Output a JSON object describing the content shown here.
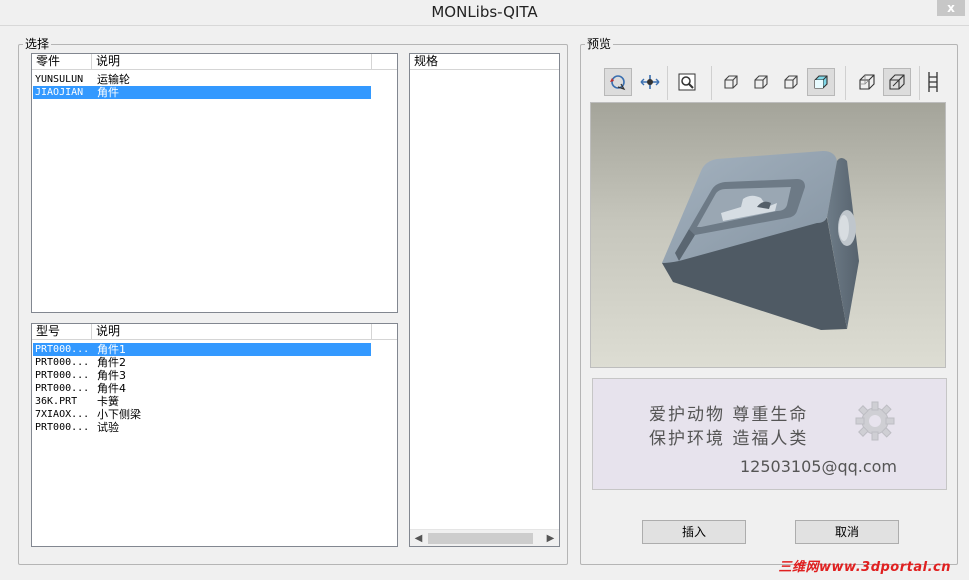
{
  "window": {
    "title": "MONLibs-QITA",
    "close_label": "x"
  },
  "select_group": {
    "label": "选择",
    "parts_list": {
      "headers": [
        "零件",
        "说明"
      ],
      "rows": [
        {
          "name": "YUNSULUN",
          "desc": "运输轮",
          "selected": false
        },
        {
          "name": "JIAOJIAN",
          "desc": "角件",
          "selected": true
        }
      ]
    },
    "models_list": {
      "headers": [
        "型号",
        "说明"
      ],
      "rows": [
        {
          "name": "PRT000...",
          "desc": "角件1",
          "selected": true
        },
        {
          "name": "PRT000...",
          "desc": "角件2",
          "selected": false
        },
        {
          "name": "PRT000...",
          "desc": "角件3",
          "selected": false
        },
        {
          "name": "PRT000...",
          "desc": "角件4",
          "selected": false
        },
        {
          "name": "36K.PRT",
          "desc": "卡簧",
          "selected": false
        },
        {
          "name": "7XIAOX...",
          "desc": "小下侧梁",
          "selected": false
        },
        {
          "name": "PRT000...",
          "desc": "试验",
          "selected": false
        }
      ]
    },
    "spec_list": {
      "header": "规格",
      "rows": []
    }
  },
  "preview_group": {
    "label": "预览",
    "toolbar": [
      {
        "icon": "spin-icon",
        "pressed": true
      },
      {
        "icon": "pan-icon",
        "pressed": false
      },
      {
        "icon": "zoom-window-icon",
        "pressed": false
      },
      {
        "icon": "view-front-icon",
        "pressed": false
      },
      {
        "icon": "view-back-icon",
        "pressed": false
      },
      {
        "icon": "view-side-icon",
        "pressed": false
      },
      {
        "icon": "shaded-view-icon",
        "pressed": true
      },
      {
        "icon": "wireframe-view-icon",
        "pressed": false
      },
      {
        "icon": "hidden-line-view-icon",
        "pressed": true
      },
      {
        "icon": "more-icon",
        "pressed": false
      }
    ],
    "ad_panel": {
      "line1": "爱护动物  尊重生命",
      "line2": "保护环境  造福人类",
      "email": "12503105@qq.com",
      "logo_icon": "gear-icon"
    },
    "insert_label": "插入",
    "cancel_label": "取消"
  },
  "watermark": "三维网www.3dportal.cn",
  "colors": {
    "selection": "#3399ff",
    "model_face": "#8d9aa6",
    "model_dark": "#4a5661"
  }
}
